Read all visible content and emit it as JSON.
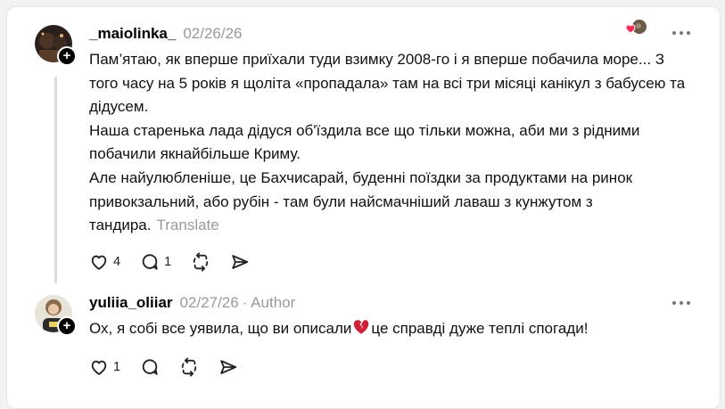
{
  "comments": [
    {
      "username": "_maiolinka_",
      "date": "02/26/26",
      "paragraphs": [
        "Пам’ятаю, як вперше приїхали туди взимку 2008-го і я вперше побачила море... З того часу на 5 років я щоліта «пропадала» там на всі три місяці канікул з бабусею та дідусем.",
        "Наша старенька лада дідуся об'їздила все що тільки можна, аби ми з рідними побачили якнайбільше Криму.",
        "Але найулюбленіше, це Бахчисарай, буденні поїздки за продуктами на ринок привокзальний, або рубін - там були найсмачніший лаваш з кунжутом з тандира."
      ],
      "translate_label": "Translate",
      "like_count": "4",
      "reply_count": "1"
    },
    {
      "username": "yuliia_oliiar",
      "date": "02/27/26",
      "author_label": "· Author",
      "text_before": "Ох, я собі все уявила, що ви описали",
      "text_after": "це справді дуже теплі спогади!",
      "emoji": "broken-heart-icon",
      "like_count": "1"
    }
  ],
  "colors": {
    "broken_heart": "#d0233a",
    "muted": "#999999"
  }
}
